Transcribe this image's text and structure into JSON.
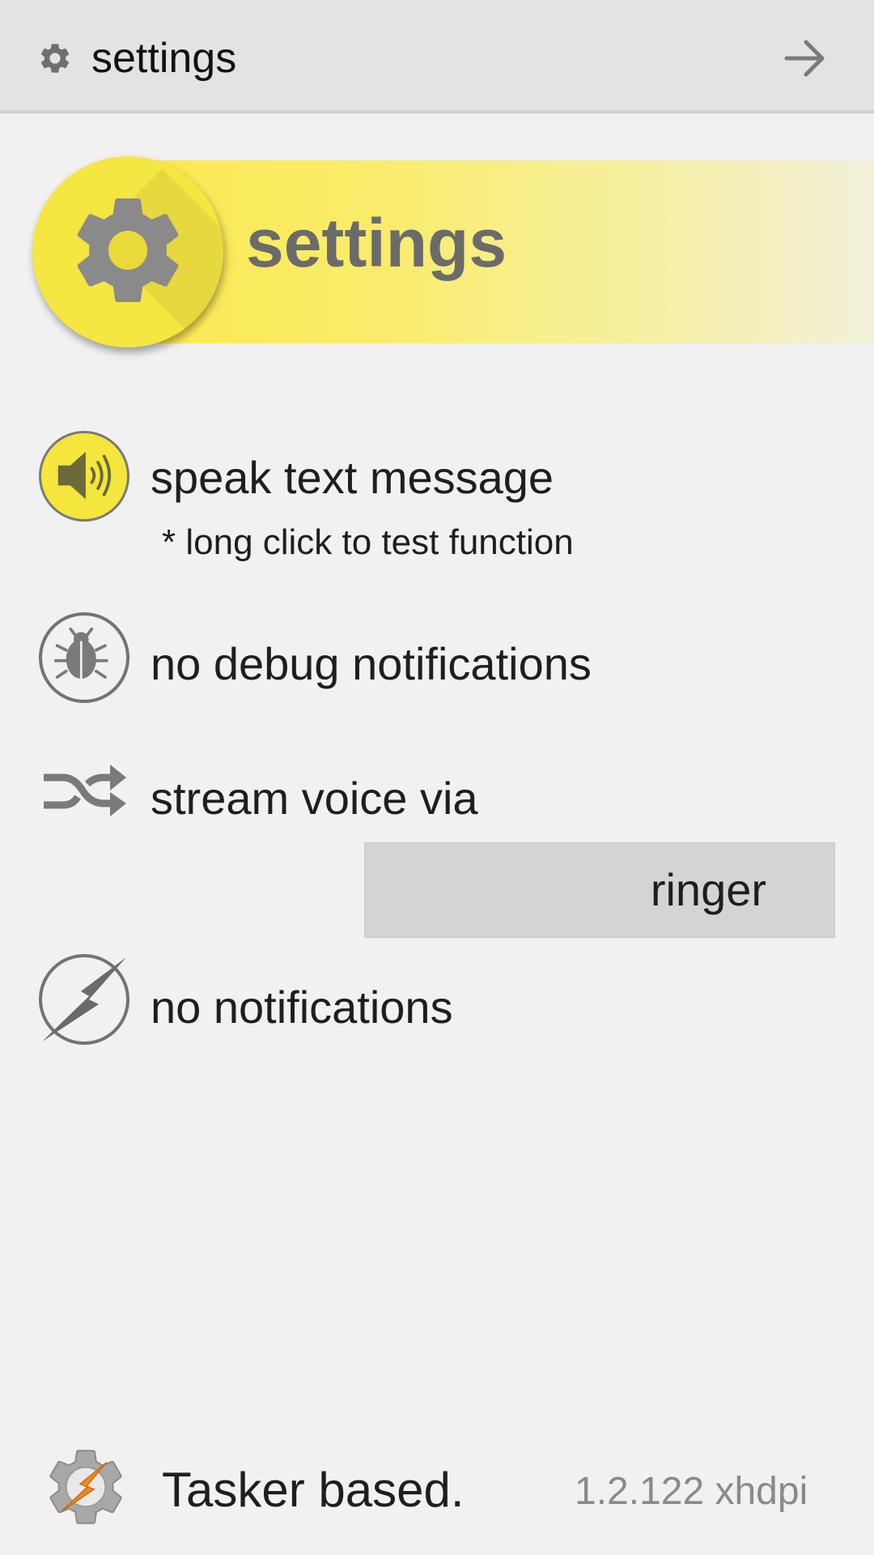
{
  "header": {
    "title": "settings",
    "icon": "gear-icon",
    "forward_icon": "arrow-right-icon"
  },
  "banner": {
    "title": "settings",
    "icon": "gear-icon"
  },
  "items": [
    {
      "label": "speak text message",
      "sublabel": "* long click to test function",
      "icon": "speaker-icon"
    },
    {
      "label": "no debug notifications",
      "icon": "bug-icon"
    },
    {
      "label": "stream voice via",
      "icon": "shuffle-icon",
      "value": "ringer"
    },
    {
      "label": "no notifications",
      "icon": "lightning-icon"
    }
  ],
  "footer": {
    "text": "Tasker based.",
    "version": "1.2.122 xhdpi",
    "icon": "tasker-logo-icon"
  },
  "colors": {
    "accent_yellow": "#f5e642",
    "icon_gray": "#737373",
    "background": "#f1f1f1",
    "topbar": "#e3e3e3",
    "dropdown": "#d4d4d4"
  }
}
